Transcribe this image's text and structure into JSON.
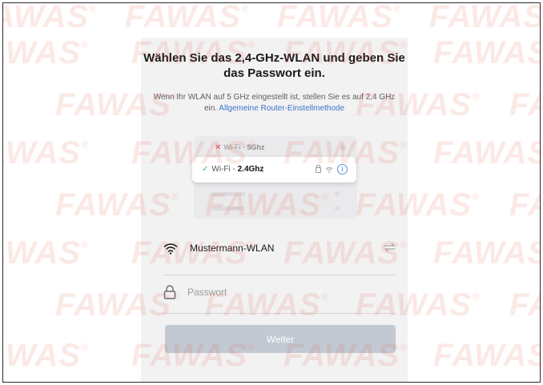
{
  "title": "Wählen Sie das 2,4-GHz-WLAN und geben Sie das Passwort ein.",
  "subtitle": "Wenn Ihr WLAN auf 5 GHz eingestellt ist, stellen Sie es auf 2,4 GHz ein.",
  "router_link": "Allgemeine Router-Einstellmethode",
  "illustration": {
    "bad_prefix": "Wi-Fi - ",
    "bad_band": "5Ghz",
    "good_prefix": "Wi-Fi - ",
    "good_band": "2.4Ghz"
  },
  "network": {
    "ssid": "Mustermann-WLAN"
  },
  "password": {
    "placeholder": "Passwort",
    "value": ""
  },
  "next_button": {
    "label": "Weiter",
    "enabled": false
  },
  "watermark": {
    "text": "FAWAS",
    "mark": "®"
  },
  "colors": {
    "accent_link": "#3b74c7",
    "button_disabled": "#c2c9d3",
    "watermark": "#e2583c",
    "check": "#3bb46a",
    "cross": "#e0484c"
  }
}
